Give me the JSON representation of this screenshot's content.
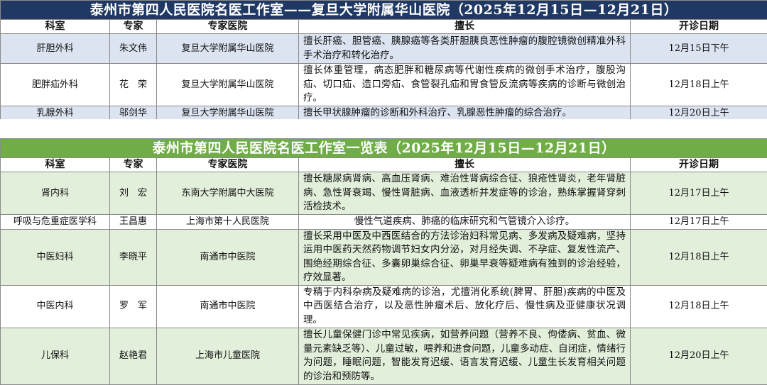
{
  "table1": {
    "title": "泰州市第四人民医院名医工作室——复旦大学附属华山医院（2025年12月15日—12月21日）",
    "headers": [
      "科室",
      "专家",
      "专家医院",
      "擅长",
      "开诊日期"
    ],
    "rows": [
      {
        "dept": "肝胆外科",
        "expert": "朱文伟",
        "hospital": "复旦大学附属华山医院",
        "specialty": "擅长肝癌、胆管癌、胰腺癌等各类肝胆胰良恶性肿瘤的腹腔镜微创精准外科手术治疗和转化治疗。",
        "date": "12月15日下午"
      },
      {
        "dept": "肥胖疝外科",
        "expert": "花　荣",
        "hospital": "复旦大学附属华山医院",
        "specialty": "擅长体重管理，病态肥胖和糖尿病等代谢性疾病的微创手术治疗，腹股沟疝、切口疝、造口旁疝、食管裂孔疝和胃食管反流病等疾病的诊断与微创治疗。",
        "date": "12月18日上午"
      },
      {
        "dept": "乳腺外科",
        "expert": "邬剑华",
        "hospital": "复旦大学附属华山医院",
        "specialty": "擅长甲状腺肿瘤的诊断和外科治疗、乳腺恶性肿瘤的综合治疗。",
        "date": "12月20日上午"
      }
    ]
  },
  "table2": {
    "title": "泰州市第四人民医院名医工作室一览表（2025年12月15日—12月21日）",
    "headers": [
      "科室",
      "专家",
      "专家医院",
      "擅长",
      "开诊日期"
    ],
    "rows": [
      {
        "dept": "肾内科",
        "expert": "刘　宏",
        "hospital": "东南大学附属中大医院",
        "specialty": "擅长糖尿病肾病、高血压肾病、难治性肾病综合征、狼疮性肾炎，老年肾脏病、急性肾衰竭、慢性肾脏病、血液透析并发症等的诊治，熟练掌握肾穿刺活检技术。",
        "date": "12月17日上午"
      },
      {
        "dept": "呼吸与危重症医学科",
        "expert": "王昌惠",
        "hospital": "上海市第十人民医院",
        "specialty": "慢性气道疾病、肺癌的临床研究和气管镜介入诊疗。",
        "date": "12月17日上午"
      },
      {
        "dept": "中医妇科",
        "expert": "李晓平",
        "hospital": "南通市中医院",
        "specialty": "擅长采用中医及中西医结合的方法诊治妇科常见病、多发病及疑难病，坚持运用中医药天然药物调节妇女内分泌，对月经失调、不孕症、复发性流产、围绝经期综合征、多囊卵巢综合征、卵巢早衰等疑难病有独到的诊治经验，疗效显著。",
        "date": "12月18日上午"
      },
      {
        "dept": "中医内科",
        "expert": "罗　军",
        "hospital": "南通市中医院",
        "specialty": "专精于内科杂病及疑难病的诊治，尤擅消化系统(脾胃、肝胆)疾病的中医及中西医结合治疗，以及恶性肿瘤术后、放化疗后、慢性病及亚健康状况调理。",
        "date": "12月18日上午"
      },
      {
        "dept": "儿保科",
        "expert": "赵艳君",
        "hospital": "上海市儿童医院",
        "specialty": "擅长儿童保健门诊中常见疾病，如营养问题（营养不良、佝偻病、贫血、微量元素缺乏等）、儿童过敏，喂养和进食问题，儿童多动症、自闭症，情绪行为问题，睡眠问题，智能发育迟缓、语言发育迟缓、儿童生长发育相关问题的诊治和预防等。",
        "date": "12月20日上午"
      }
    ]
  },
  "colors": {
    "title1_bg": "#1f3864",
    "row1_highlight": "#dce4f2",
    "title2_bg": "#70ad47",
    "row2_highlight": "#e2efda"
  }
}
